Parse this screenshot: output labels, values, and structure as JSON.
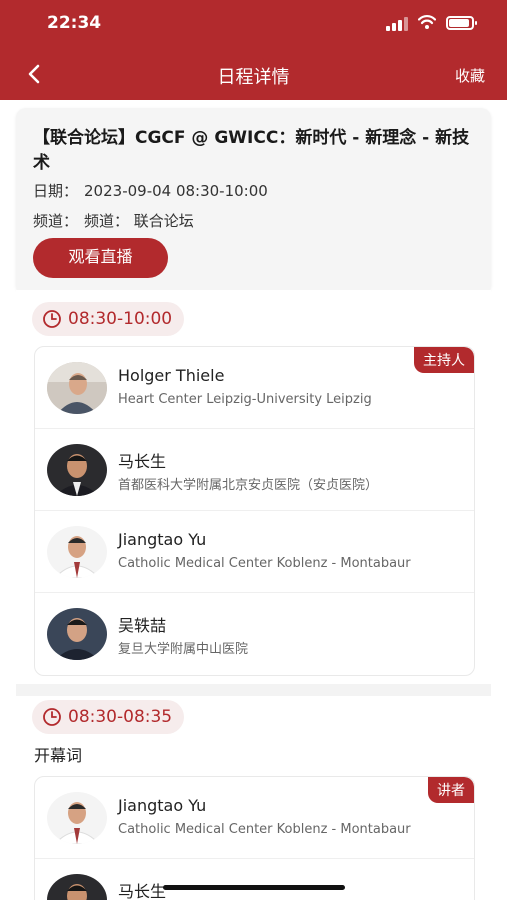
{
  "status_bar": {
    "time": "22:34"
  },
  "nav": {
    "title": "日程详情",
    "favorite_label": "收藏"
  },
  "session": {
    "title": "【联合论坛】CGCF @ GWICC：新时代 - 新理念 - 新技术",
    "date_label": "日期：",
    "date_value": "2023-09-04 08:30-10:00",
    "channel_label": "频道：",
    "channel_value": "频道：  联合论坛",
    "live_button": "观看直播"
  },
  "blocks": [
    {
      "time": "08:30-10:00",
      "role": "主持人",
      "speakers": [
        {
          "name": "Holger Thiele",
          "org": "Heart Center Leipzig-University Leipzig"
        },
        {
          "name": "马长生",
          "org": "首都医科大学附属北京安贞医院（安贞医院）"
        },
        {
          "name": "Jiangtao Yu",
          "org": "Catholic Medical Center Koblenz - Montabaur"
        },
        {
          "name": "吴轶喆",
          "org": "复旦大学附属中山医院"
        }
      ]
    },
    {
      "time": "08:30-08:35",
      "topic": "开幕词",
      "role": "讲者",
      "speakers": [
        {
          "name": "Jiangtao Yu",
          "org": "Catholic Medical Center Koblenz - Montabaur"
        },
        {
          "name": "马长生",
          "org": ""
        }
      ]
    }
  ],
  "colors": {
    "brand": "#b22a2d",
    "pill_bg": "#f6ecec"
  },
  "icons": {
    "back": "chevron-left-icon",
    "clock": "clock-icon",
    "wifi": "wifi-icon",
    "signal": "signal-icon",
    "battery": "battery-icon"
  }
}
